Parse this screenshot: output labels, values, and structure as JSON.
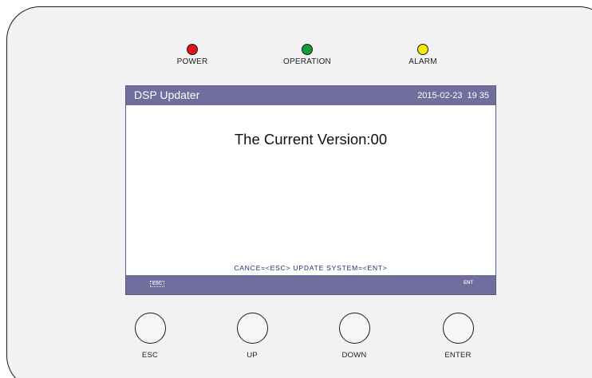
{
  "leds": [
    {
      "label": "POWER",
      "color": "#e0131b"
    },
    {
      "label": "OPERATION",
      "color": "#0f9d3a"
    },
    {
      "label": "ALARM",
      "color": "#f3ea10"
    }
  ],
  "screen": {
    "title": "DSP Updater",
    "date": "2015-02-23",
    "time": "19 35",
    "message": "The Current Version:00",
    "hint": "CANCE=<ESC>  UPDATE SYSTEM=<ENT>",
    "footer_left": "ESC",
    "footer_right": "ENT"
  },
  "buttons": [
    {
      "label": "ESC"
    },
    {
      "label": "UP"
    },
    {
      "label": "DOWN"
    },
    {
      "label": "ENTER"
    }
  ]
}
